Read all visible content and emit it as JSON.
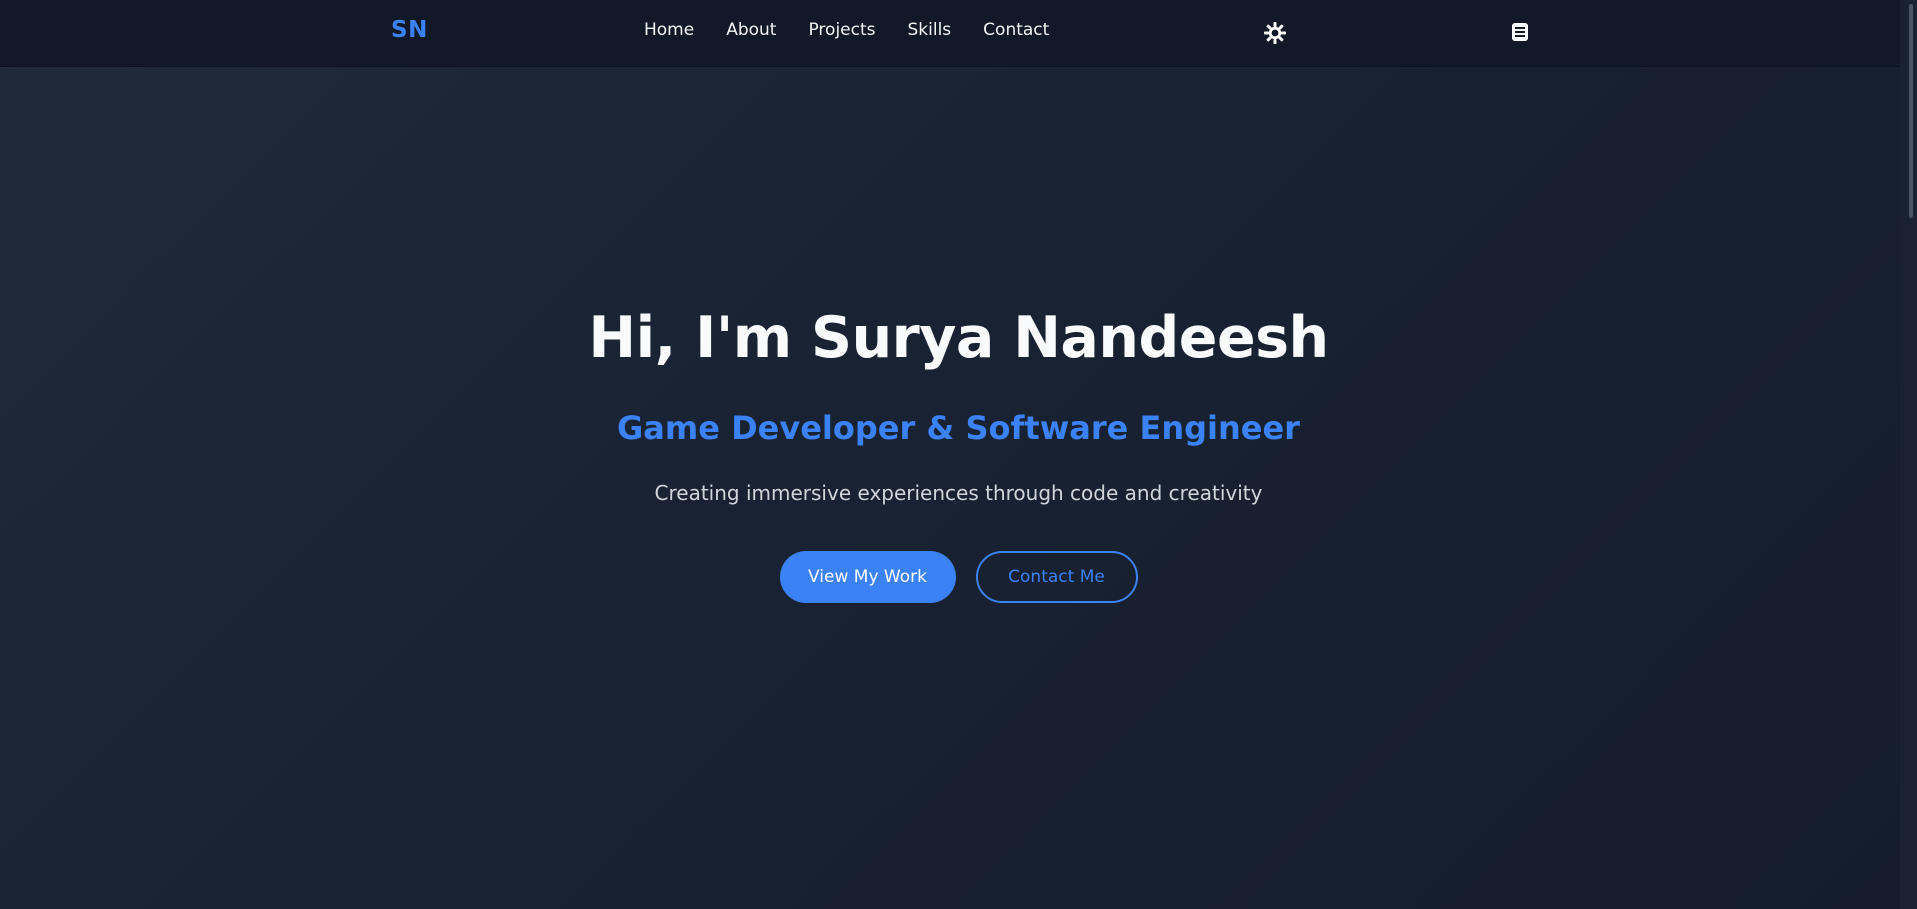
{
  "colors": {
    "accent": "#3b82f6",
    "navbar_bg": "#111827",
    "page_bg": "#1b2333",
    "text_primary": "#f9fafb",
    "text_secondary": "#d1d5db"
  },
  "navbar": {
    "logo": "SN",
    "links": [
      "Home",
      "About",
      "Projects",
      "Skills",
      "Contact"
    ],
    "theme_toggle_icon": "sun-icon",
    "menu_icon": "document-icon"
  },
  "hero": {
    "title": "Hi, I'm Surya Nandeesh",
    "subtitle": "Game Developer & Software Engineer",
    "tagline": "Creating immersive experiences through code and creativity",
    "primary_button": "View My Work",
    "secondary_button": "Contact Me"
  }
}
